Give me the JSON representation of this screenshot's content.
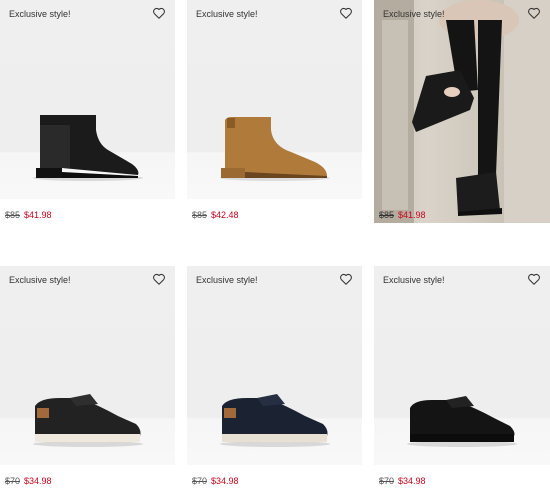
{
  "products": [
    {
      "badge": "Exclusive style!",
      "old_price": "$85",
      "new_price": "$41.98",
      "icon": "heart-icon"
    },
    {
      "badge": "Exclusive style!",
      "old_price": "$85",
      "new_price": "$42.48",
      "icon": "heart-icon"
    },
    {
      "badge": "Exclusive style!",
      "old_price": "$85",
      "new_price": "$41.98",
      "icon": "heart-icon"
    },
    {
      "badge": "Exclusive style!",
      "old_price": "$70",
      "new_price": "$34.98",
      "icon": "heart-icon"
    },
    {
      "badge": "Exclusive style!",
      "old_price": "$70",
      "new_price": "$34.98",
      "icon": "heart-icon"
    },
    {
      "badge": "Exclusive style!",
      "old_price": "$70",
      "new_price": "$34.98",
      "icon": "heart-icon"
    }
  ],
  "colors": {
    "sale": "#d0021b",
    "image_bg": "#eeeeee"
  }
}
